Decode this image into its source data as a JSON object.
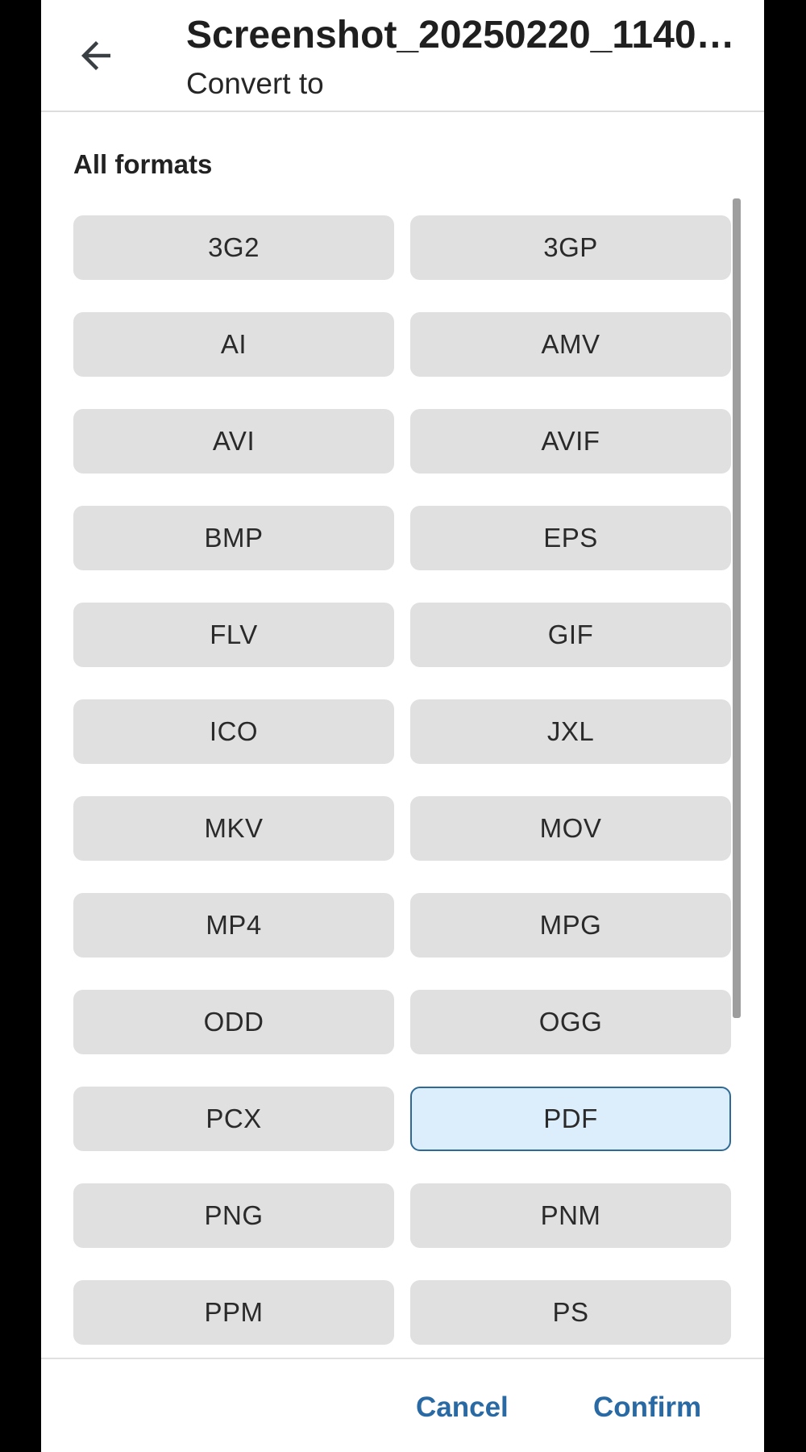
{
  "header": {
    "title": "Screenshot_20250220_1140…",
    "subtitle": "Convert to",
    "back_icon": "arrow-left-icon"
  },
  "section": {
    "label": "All formats"
  },
  "formats": [
    "3G2",
    "3GP",
    "AI",
    "AMV",
    "AVI",
    "AVIF",
    "BMP",
    "EPS",
    "FLV",
    "GIF",
    "ICO",
    "JXL",
    "MKV",
    "MOV",
    "MP4",
    "MPG",
    "ODD",
    "OGG",
    "PCX",
    "PDF",
    "PNG",
    "PNM",
    "PPM",
    "PS"
  ],
  "selected_format": "PDF",
  "footer": {
    "cancel_label": "Cancel",
    "confirm_label": "Confirm"
  },
  "colors": {
    "accent": "#2a6aa4",
    "selected_bg": "#dcedfb",
    "selected_border": "#2f6a94",
    "button_bg": "#e0e0e0"
  }
}
